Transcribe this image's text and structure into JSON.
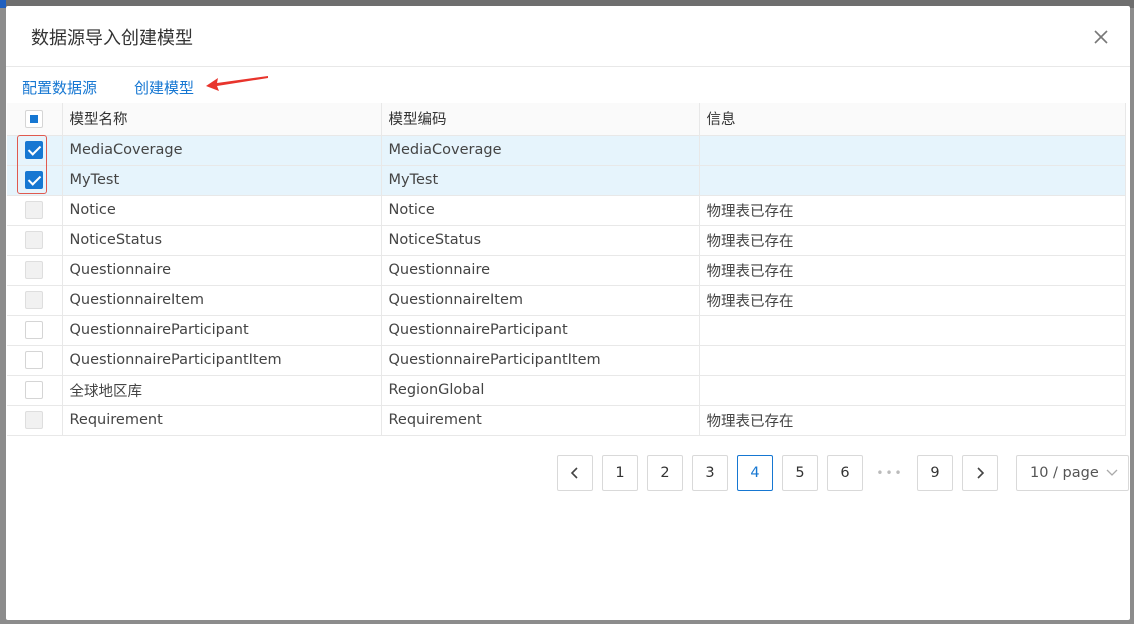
{
  "dialog": {
    "title": "数据源导入创建模型"
  },
  "actions": {
    "configure_datasource": "配置数据源",
    "create_model": "创建模型"
  },
  "table": {
    "columns": [
      "模型名称",
      "模型编码",
      "信息"
    ],
    "rows": [
      {
        "name": "MediaCoverage",
        "code": "MediaCoverage",
        "info": "",
        "checked": true,
        "disabled": false
      },
      {
        "name": "MyTest",
        "code": "MyTest",
        "info": "",
        "checked": true,
        "disabled": false
      },
      {
        "name": "Notice",
        "code": "Notice",
        "info": "物理表已存在",
        "checked": false,
        "disabled": true
      },
      {
        "name": "NoticeStatus",
        "code": "NoticeStatus",
        "info": "物理表已存在",
        "checked": false,
        "disabled": true
      },
      {
        "name": "Questionnaire",
        "code": "Questionnaire",
        "info": "物理表已存在",
        "checked": false,
        "disabled": true
      },
      {
        "name": "QuestionnaireItem",
        "code": "QuestionnaireItem",
        "info": "物理表已存在",
        "checked": false,
        "disabled": true
      },
      {
        "name": "QuestionnaireParticipant",
        "code": "QuestionnaireParticipant",
        "info": "",
        "checked": false,
        "disabled": false
      },
      {
        "name": "QuestionnaireParticipantItem",
        "code": "QuestionnaireParticipantItem",
        "info": "",
        "checked": false,
        "disabled": false
      },
      {
        "name": "全球地区库",
        "code": "RegionGlobal",
        "info": "",
        "checked": false,
        "disabled": false
      },
      {
        "name": "Requirement",
        "code": "Requirement",
        "info": "物理表已存在",
        "checked": false,
        "disabled": true
      }
    ]
  },
  "pagination": {
    "prev_icon": "chevron-left-icon",
    "next_icon": "chevron-right-icon",
    "pages": [
      "1",
      "2",
      "3",
      "4",
      "5",
      "6",
      "•••",
      "9"
    ],
    "current_page": "4",
    "page_size": "10 / page"
  },
  "colors": {
    "accent": "#1677d2",
    "selected_row": "#e6f4fc",
    "highlight_box": "#e05a4f",
    "arrow": "#e8342c"
  }
}
